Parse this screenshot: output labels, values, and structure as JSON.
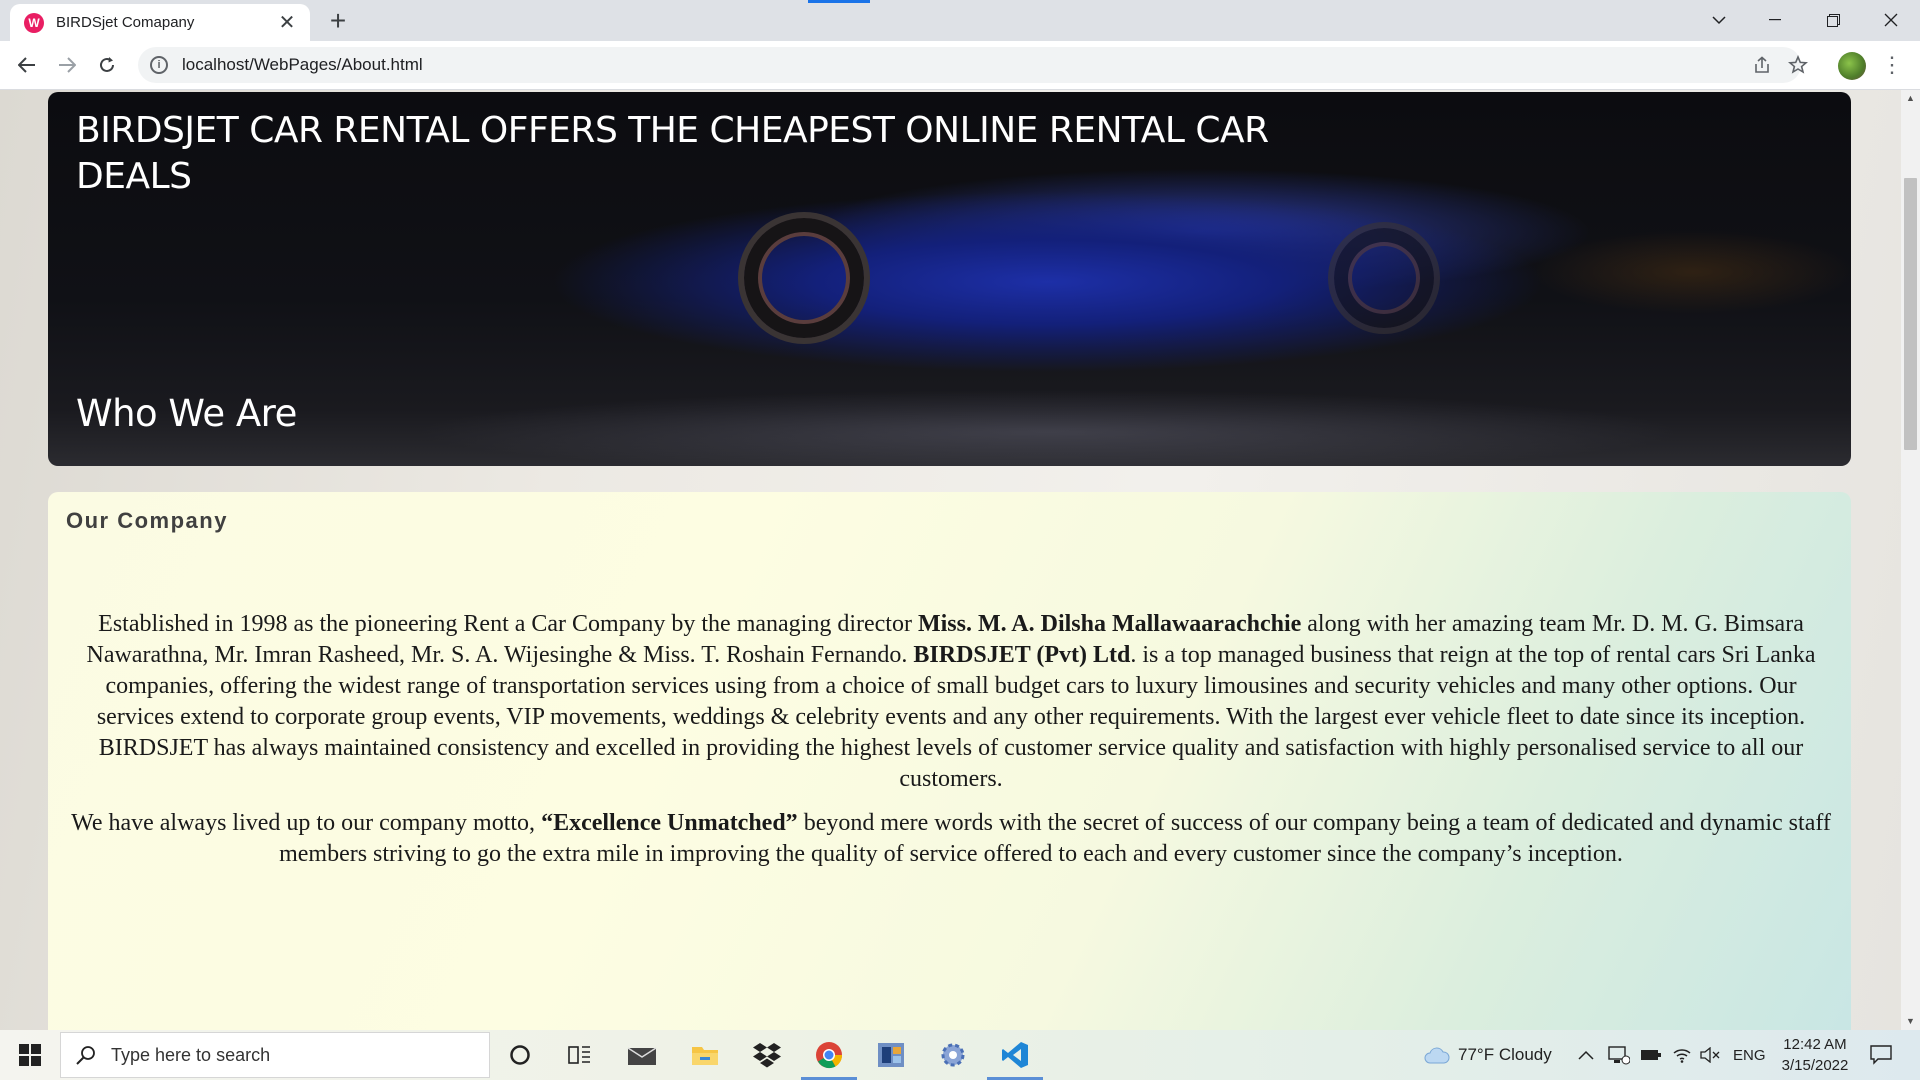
{
  "browser": {
    "tab_title": "BIRDSjet Comapany",
    "favicon_letter": "W",
    "url": "localhost/WebPages/About.html"
  },
  "hero": {
    "title": "BIRDSJET CAR RENTAL OFFERS THE CHEAPEST ONLINE RENTAL CAR DEALS",
    "subtitle": "Who We Are"
  },
  "company": {
    "heading": "Our Company",
    "para1": {
      "t1": "Established in 1998 as the pioneering Rent a Car Company by the managing director ",
      "b1": "Miss. M. A. Dilsha Mallawaarachchie",
      "t2": " along with her amazing team Mr. D. M. G. Bimsara Nawarathna, Mr. Imran Rasheed, Mr. S. A. Wijesinghe & Miss. T. Roshain Fernando. ",
      "b2": "BIRDSJET (Pvt) Ltd",
      "t3": ". is a top managed business that reign at the top of rental cars Sri Lanka companies, offering the widest range of transportation services using from a choice of small budget cars to luxury limousines and security vehicles and many other options. Our services extend to corporate group events, VIP movements, weddings & celebrity events and any other requirements. With the largest ever vehicle fleet to date since its inception. BIRDSJET has always maintained consistency and excelled in providing the highest levels of customer service quality and satisfaction with highly personalised service to all our customers."
    },
    "para2": {
      "t1": "We have always lived up to our company motto, ",
      "b1": "“Excellence Unmatched”",
      "t2": " beyond mere words with the secret of success of our company being a team of dedicated and dynamic staff members striving to go the extra mile in improving the quality of service offered to each and every customer since the company’s inception."
    }
  },
  "taskbar": {
    "search_placeholder": "Type here to search",
    "weather": "77°F  Cloudy",
    "language": "ENG",
    "time": "12:42 AM",
    "date": "3/15/2022",
    "apps": [
      "cortana-icon",
      "task-view-icon",
      "mail-icon",
      "file-explorer-icon",
      "dropbox-icon",
      "chrome-icon",
      "app-icon",
      "settings-icon",
      "vscode-icon"
    ]
  },
  "colors": {
    "tab_favicon": "#e91e63",
    "hero_text": "#ffffff",
    "company_bg": "#fdfde2",
    "taskbar_accent": "#5b8fd6"
  }
}
